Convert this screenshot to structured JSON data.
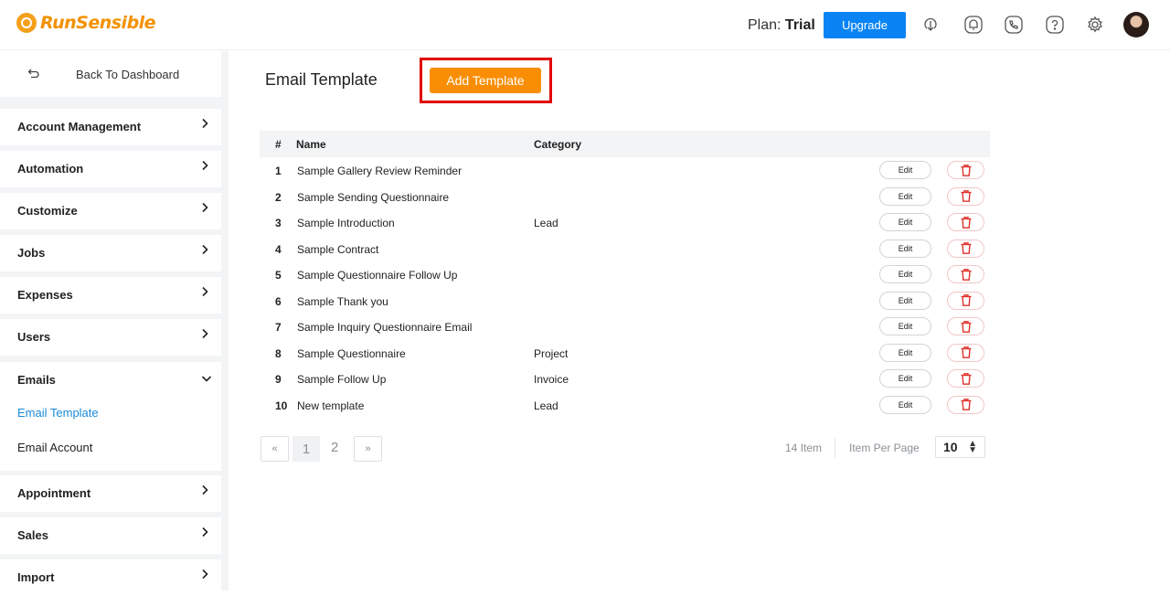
{
  "header": {
    "logo_text": "RunSensible",
    "plan_label": "Plan:",
    "plan_value": "Trial",
    "upgrade_label": "Upgrade",
    "icons": [
      "add-icon",
      "notification-icon",
      "phone-icon",
      "help-icon",
      "settings-icon",
      "avatar"
    ]
  },
  "sidebar": {
    "back_label": "Back To Dashboard",
    "items": [
      {
        "label": "Account Management"
      },
      {
        "label": "Automation"
      },
      {
        "label": "Customize"
      },
      {
        "label": "Jobs"
      },
      {
        "label": "Expenses"
      },
      {
        "label": "Users"
      },
      {
        "label": "Emails"
      },
      {
        "label": "Appointment"
      },
      {
        "label": "Sales"
      },
      {
        "label": "Import"
      }
    ],
    "emails_sub": [
      "Email Template",
      "Email Account"
    ]
  },
  "main": {
    "title": "Email Template",
    "add_label": "Add Template",
    "columns": [
      "#",
      "Name",
      "Category"
    ],
    "edit_label": "Edit",
    "rows": [
      {
        "num": "1",
        "name": "Sample Gallery Review Reminder",
        "category": ""
      },
      {
        "num": "2",
        "name": "Sample Sending Questionnaire",
        "category": ""
      },
      {
        "num": "3",
        "name": "Sample Introduction",
        "category": "Lead"
      },
      {
        "num": "4",
        "name": "Sample Contract",
        "category": ""
      },
      {
        "num": "5",
        "name": "Sample Questionnaire Follow Up",
        "category": ""
      },
      {
        "num": "6",
        "name": "Sample Thank you",
        "category": ""
      },
      {
        "num": "7",
        "name": "Sample Inquiry Questionnaire Email",
        "category": ""
      },
      {
        "num": "8",
        "name": "Sample Questionnaire",
        "category": "Project"
      },
      {
        "num": "9",
        "name": "Sample Follow Up",
        "category": "Invoice"
      },
      {
        "num": "10",
        "name": "New template",
        "category": "Lead"
      }
    ],
    "pagination": {
      "prev": "«",
      "pages": [
        "1",
        "2"
      ],
      "next": "»",
      "total": "14 Item",
      "per_page_label": "Item Per Page",
      "per_page_value": "10"
    }
  },
  "colors": {
    "accent": "#0a84f4",
    "add_button": "#f98e05",
    "highlight": "#e10000",
    "active_link": "#1a8ad6"
  }
}
